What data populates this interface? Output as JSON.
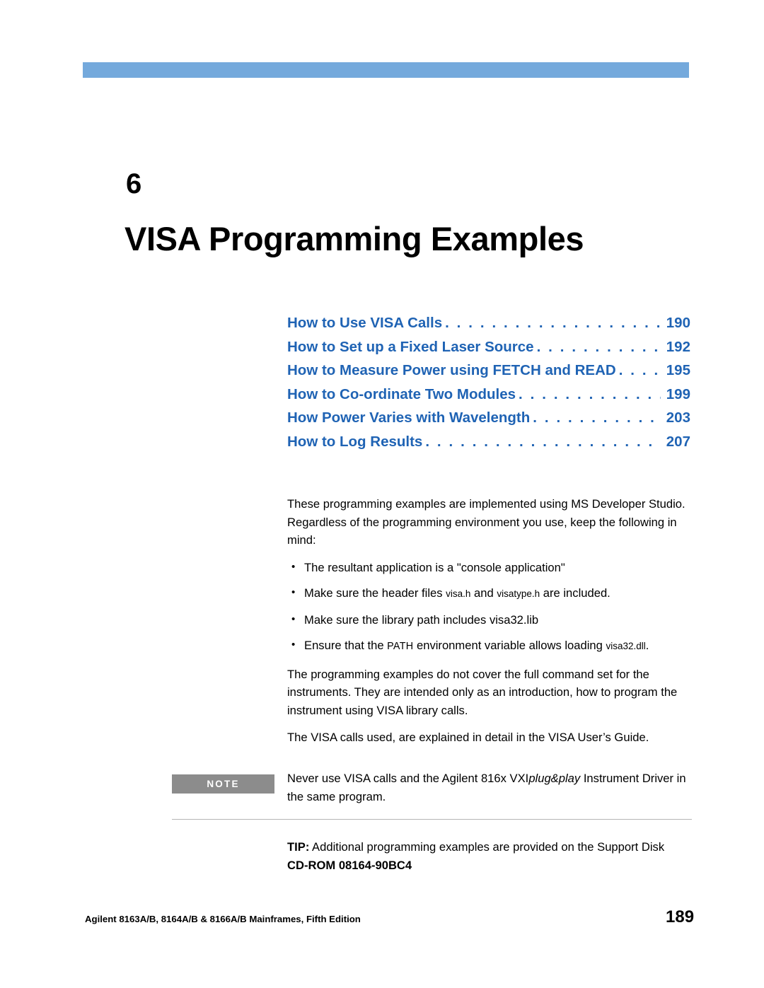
{
  "document": {
    "chapter_number": "6",
    "chapter_title": "VISA Programming Examples",
    "accent_color": "#74a9dc",
    "toc_color": "#1f63b4"
  },
  "toc": [
    {
      "label": "How to Use VISA Calls",
      "page": "190"
    },
    {
      "label": "How to Set up a Fixed Laser Source",
      "page": "192"
    },
    {
      "label": "How to Measure Power using FETCH and READ",
      "page": "195"
    },
    {
      "label": "How to Co-ordinate Two Modules",
      "page": "199"
    },
    {
      "label": "How Power Varies with Wavelength",
      "page": "203"
    },
    {
      "label": "How to Log Results",
      "page": "207"
    }
  ],
  "body": {
    "intro": "These programming examples are implemented using MS Developer Studio. Regardless of the programming environment you use, keep the following in mind:",
    "bullet1": "The resultant application is a \"console application\"",
    "bullet2_pre": "Make sure the header files ",
    "bullet2_code1": "visa.h",
    "bullet2_mid": " and ",
    "bullet2_code2": "visatype.h",
    "bullet2_post": " are included.",
    "bullet3": "Make sure the library path includes visa32.lib",
    "bullet4_pre": "Ensure that the ",
    "bullet4_sc": "PATH",
    "bullet4_mid": " environment variable allows loading ",
    "bullet4_code": "visa32.dll",
    "bullet4_post": ".",
    "para2": "The programming examples do not cover the full command set for the instruments. They are intended only as an introduction, how to program the instrument using VISA library calls.",
    "para3": "The VISA calls used, are explained in detail in the VISA User’s Guide."
  },
  "note": {
    "flag_label": "NOTE",
    "text_pre": "Never use VISA calls and the Agilent 816x VXI",
    "text_italic": "plug&play",
    "text_post": " Instrument Driver in the same program."
  },
  "tip": {
    "label": "TIP:",
    "text": " Additional programming examples are provided on the Support Disk",
    "line2": "CD-ROM 08164-90BC4"
  },
  "footer": {
    "left": "Agilent 8163A/B, 8164A/B & 8166A/B Mainframes, Fifth Edition",
    "page_number": "189"
  }
}
